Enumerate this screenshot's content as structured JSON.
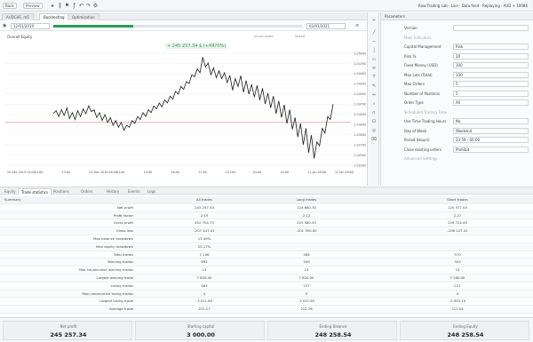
{
  "topbar": {
    "left_button": "Back",
    "preview_button": "Preview",
    "right_text": "Raw Trading Lab · Live · Data feed · Replaying · AUD + 10086"
  },
  "tabs": [
    {
      "label": "AUDCHF, m5"
    },
    {
      "label": "Backtesting"
    },
    {
      "label": "Optimization"
    }
  ],
  "controls": {
    "date_from": "12/01/2019",
    "date_to": "03/01/2021",
    "progress": 0.32,
    "checkbox_label": "Visual mode",
    "speed_label": "Speed"
  },
  "chart": {
    "title": "Overall Equity",
    "result_text": "+ 245 257.34 $ (+4970%)"
  },
  "params": {
    "header": "Parameters",
    "rows": [
      {
        "label": "Version",
        "value": ""
      },
      {
        "label": "Main Indicators",
        "value": "",
        "section": true
      },
      {
        "label": "Capital Management",
        "value": "Risk"
      },
      {
        "label": "Risk %",
        "value": "20"
      },
      {
        "label": "Fixed Money (USD)",
        "value": "100"
      },
      {
        "label": "Max Lots (Total)",
        "value": "100"
      },
      {
        "label": "Max Orders",
        "value": "5"
      },
      {
        "label": "Number of Positions",
        "value": "5"
      },
      {
        "label": "Order Type",
        "value": "All"
      },
      {
        "label": "Scheduled Trading Time",
        "value": "",
        "section": true
      },
      {
        "label": "Use Time Trading Hours",
        "value": "No"
      },
      {
        "label": "Day of Week",
        "value": "Weekend"
      },
      {
        "label": "Period (Hours)",
        "value": "23:59 - 00:00"
      },
      {
        "label": "Close existing orders",
        "value": "Prohibit"
      },
      {
        "label": "Advanced Settings",
        "value": "",
        "section": true
      }
    ]
  },
  "bottom_tabs": [
    "Equity",
    "Trade statistics",
    "Positions",
    "Orders",
    "History",
    "Events",
    "Logs"
  ],
  "table": {
    "headers": [
      "Summary",
      "All trades",
      "Long trades",
      "Short trades"
    ],
    "rows": [
      {
        "label": "Net profit",
        "all": "245 257.34",
        "long": "124 680.30",
        "short": "120 577.04"
      },
      {
        "label": "Profit factor",
        "all": "2.19",
        "long": "2.12",
        "short": "2.27"
      },
      {
        "label": "Gross profit",
        "all": "452 704.75",
        "long": "225 980.30",
        "short": "226 724.45"
      },
      {
        "label": "Gross loss",
        "all": "-207 447.41",
        "long": "-101 300.00",
        "short": "-106 147.41"
      },
      {
        "label": "Max balance drawdown",
        "all": "13.49%",
        "long": "",
        "short": ""
      },
      {
        "label": "Max equity drawdown",
        "all": "23.17%",
        "long": "",
        "short": ""
      },
      {
        "label": "Total trades",
        "all": "1 156",
        "long": "586",
        "short": "570"
      },
      {
        "label": "Winning trades",
        "all": "692",
        "long": "349",
        "short": "343"
      },
      {
        "label": "Max consecutive winning trades",
        "all": "13",
        "long": "13",
        "short": "15"
      },
      {
        "label": "Largest winning trade",
        "all": "7 820.00",
        "long": "7 820.00",
        "short": "7 160.00"
      },
      {
        "label": "Losing trades",
        "all": "464",
        "long": "237",
        "short": "227"
      },
      {
        "label": "Max consecutive losing trades",
        "all": "4",
        "long": "5",
        "short": "4"
      },
      {
        "label": "Largest losing trade",
        "all": "-3 021.80",
        "long": "-3 021.80",
        "short": "-2 955.10"
      },
      {
        "label": "Average trade",
        "all": "212.17",
        "long": "212.76",
        "short": "211.54"
      }
    ]
  },
  "summary": [
    {
      "label": "Net profit",
      "value": "245 257.34"
    },
    {
      "label": "Starting capital",
      "value": "3 000.00"
    },
    {
      "label": "Ending Balance",
      "value": "248 258.54"
    },
    {
      "label": "Ending Equity",
      "value": "248 258.54"
    }
  ],
  "chart_data": {
    "type": "line",
    "x_labels": [
      "20 Dec 2019 12:00",
      "13:00",
      "23:00",
      "23 Dec 2019 09:00",
      "11:00",
      "15:00",
      "16:00",
      "17:00",
      "22 Dec",
      "03:00",
      "10:00",
      "11 Jan 09:00",
      "12 Jan 09:00"
    ],
    "y_labels": [
      "1.05000",
      "1.04700",
      "1.04400",
      "1.04200",
      "1.04000",
      "1.03700",
      "1.03500",
      "1.03200",
      "1.03000",
      "1.02700",
      "1.02500",
      "1.02200"
    ],
    "values": [
      1.0408,
      1.0411,
      1.0405,
      1.0412,
      1.0406,
      1.0414,
      1.0403,
      1.0409,
      1.0402,
      1.0411,
      1.0405,
      1.0413,
      1.0408,
      1.0416,
      1.041,
      1.0412,
      1.0404,
      1.0409,
      1.0401,
      1.0407,
      1.0399,
      1.0404,
      1.0396,
      1.0401,
      1.0394,
      1.0399,
      1.0391,
      1.0396,
      1.0394,
      1.0401,
      1.0398,
      1.0405,
      1.0402,
      1.0409,
      1.0405,
      1.0412,
      1.0409,
      1.0416,
      1.0413,
      1.0419,
      1.0415,
      1.0422,
      1.0419,
      1.0426,
      1.0423,
      1.0431,
      1.0428,
      1.0436,
      1.0433,
      1.0441,
      1.0439,
      1.0448,
      1.0446,
      1.0454,
      1.045,
      1.0466,
      1.0456,
      1.046,
      1.0448,
      1.0455,
      1.0445,
      1.0452,
      1.0444,
      1.045,
      1.044,
      1.0447,
      1.0432,
      1.0444,
      1.0436,
      1.0447,
      1.043,
      1.0442,
      1.0428,
      1.0438,
      1.0425,
      1.0437,
      1.0422,
      1.0434,
      1.0418,
      1.0429,
      1.0414,
      1.0426,
      1.0408,
      1.0421,
      1.0404,
      1.0417,
      1.0398,
      1.0412,
      1.0392,
      1.0404,
      1.0384,
      1.0398,
      1.0376,
      1.0393,
      1.0368,
      1.0386,
      1.0362,
      1.0379,
      1.0375,
      1.0393,
      1.0388,
      1.0405,
      1.0402,
      1.0418
    ],
    "reference_line": 1.0399,
    "line_color": "#1a1a1a",
    "reference_color": "#e08080"
  }
}
